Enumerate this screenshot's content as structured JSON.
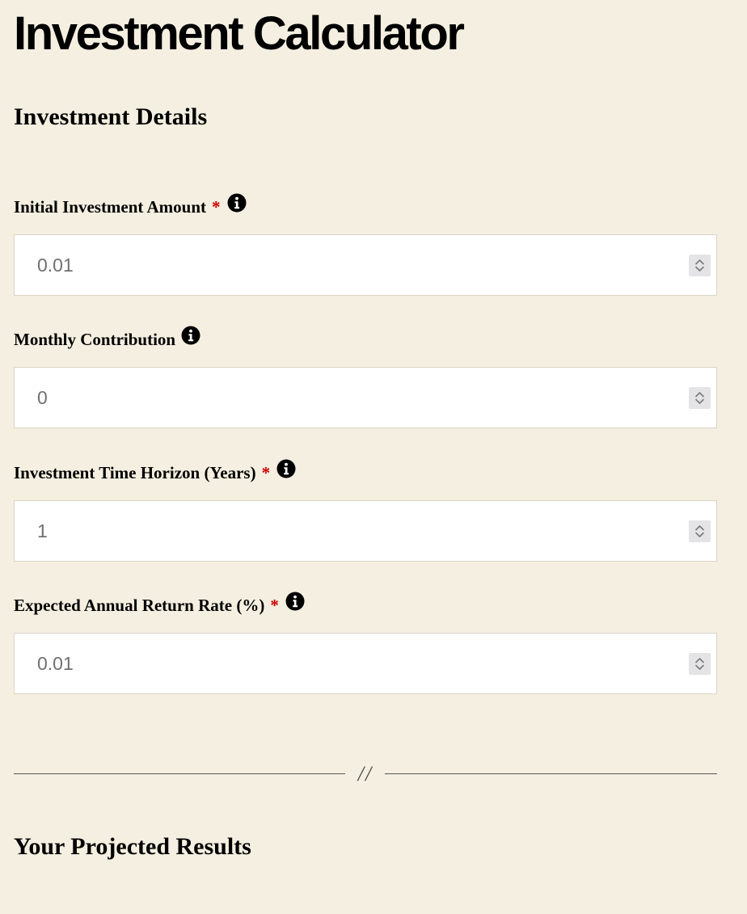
{
  "page": {
    "title": "Investment Calculator"
  },
  "details": {
    "heading": "Investment Details",
    "fields": [
      {
        "label": "Initial Investment Amount",
        "required": "*",
        "value": "0.01",
        "info_icon": "info-circle-icon"
      },
      {
        "label": "Monthly Contribution",
        "required": "",
        "value": "0",
        "info_icon": "info-circle-icon"
      },
      {
        "label": "Investment Time Horizon (Years)",
        "required": "*",
        "value": "1",
        "info_icon": "info-circle-icon"
      },
      {
        "label": "Expected Annual Return Rate (%)",
        "required": "*",
        "value": "0.01",
        "info_icon": "info-circle-icon"
      }
    ]
  },
  "divider": {
    "mark": "//"
  },
  "results": {
    "heading": "Your Projected Results"
  },
  "colors": {
    "background": "#f4efe0",
    "required": "#cc0000",
    "input_text": "#707070"
  }
}
